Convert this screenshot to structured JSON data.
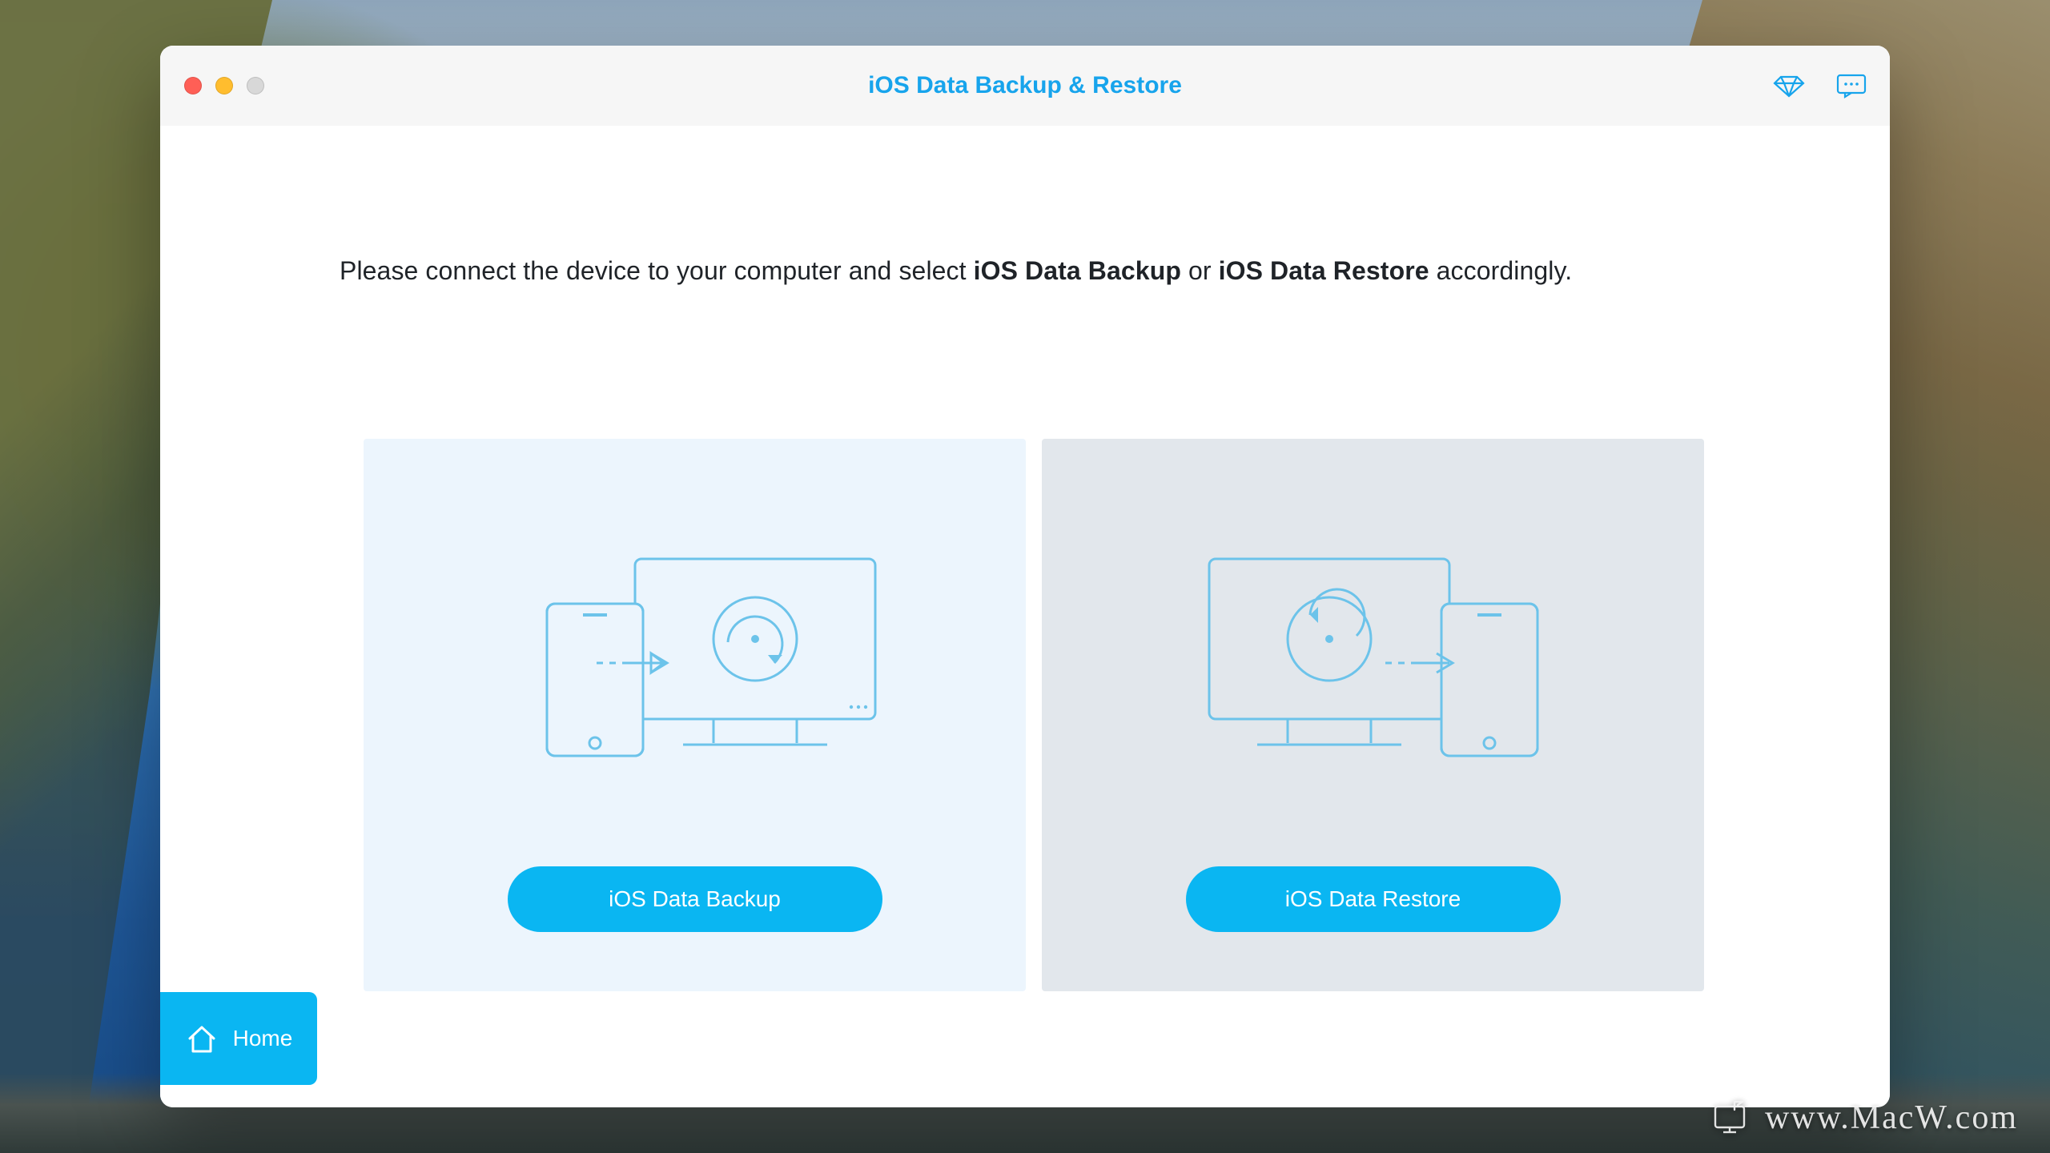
{
  "window": {
    "title": "iOS Data Backup & Restore"
  },
  "instruction": {
    "prefix": "Please connect the device to your computer and select ",
    "bold1": "iOS Data Backup",
    "mid": " or ",
    "bold2": "iOS Data Restore",
    "suffix": " accordingly."
  },
  "cards": {
    "backup_label": "iOS Data Backup",
    "restore_label": "iOS Data Restore"
  },
  "home": {
    "label": "Home"
  },
  "watermark": {
    "text": "www.MacW.com"
  },
  "colors": {
    "accent": "#0ab6f2",
    "title": "#17a4ec",
    "stroke": "#6cc3ea"
  }
}
